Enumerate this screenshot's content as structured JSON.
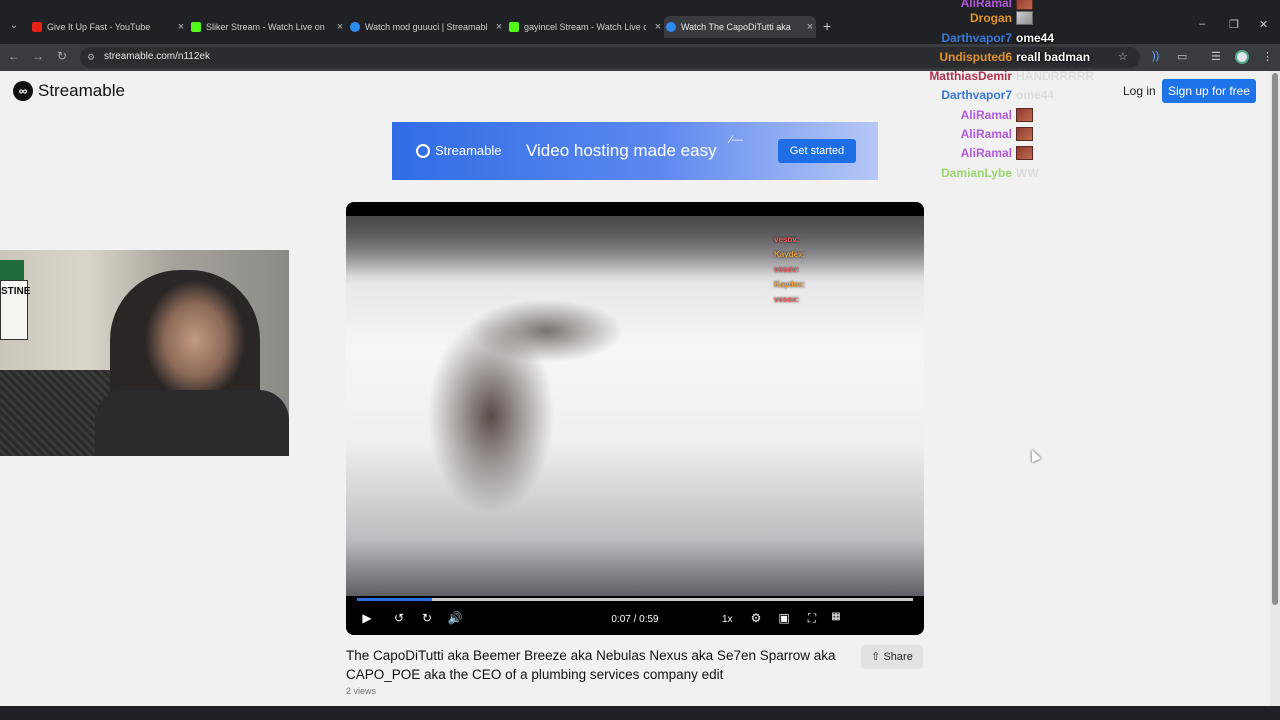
{
  "browser": {
    "tabs": [
      {
        "title": "Give It Up Fast - YouTube",
        "fav_color": "#e62117"
      },
      {
        "title": "Sliker Stream - Watch Live on K",
        "fav_color": "#53fc18"
      },
      {
        "title": "Watch mod guuuci | Streamable",
        "fav_color": "#2d8cf0"
      },
      {
        "title": "gayincel Stream - Watch Live on",
        "fav_color": "#53fc18"
      },
      {
        "title": "Watch The CapoDiTutti aka Bee",
        "fav_color": "#2d8cf0"
      }
    ],
    "url": "streamable.com/n112ek"
  },
  "site": {
    "logo": "Streamable",
    "login": "Log in",
    "signup": "Sign up for free"
  },
  "banner": {
    "logo": "Streamable",
    "text": "Video hosting made easy",
    "button": "Get started"
  },
  "player": {
    "time": "0:07 / 0:59",
    "speed": "1x",
    "progress_fraction": 0.135,
    "overlay_chat": [
      {
        "name": "vesov:",
        "color": "#ff5a5a"
      },
      {
        "name": "Kaydex:",
        "color": "#f2a23a"
      },
      {
        "name": "vesov:",
        "color": "#ff5a5a"
      },
      {
        "name": "Kaydex:",
        "color": "#f2a23a"
      },
      {
        "name": "vesox:",
        "color": "#ff5a5a"
      }
    ]
  },
  "video": {
    "title": "The CapoDiTutti aka Beemer Breeze aka Nebulas Nexus aka Se7en Sparrow aka CAPO_POE aka the CEO of a plumbing services company edit",
    "views": "2 views",
    "share": "Share"
  },
  "webcam": {
    "sign_text": "STINE"
  },
  "chat": [
    {
      "name": "AliRamal",
      "color": "#b25ad9",
      "msg": "",
      "emote": true
    },
    {
      "name": "Drogan",
      "color": "#e0932a",
      "msg": "",
      "emote": true
    },
    {
      "name": "Darthvapor7",
      "color": "#3a78d8",
      "msg": "ome44",
      "emote": false
    },
    {
      "name": "Undisputed6",
      "color": "#e0932a",
      "msg": "reall badman",
      "emote": false
    },
    {
      "name": "MatthiasDemir",
      "color": "#b0304a",
      "msg": "HANDRRRRR",
      "emote": false,
      "faded": true
    },
    {
      "name": "Darthvapor7",
      "color": "#3a78d8",
      "msg": "ome44",
      "emote": false,
      "faded": true
    },
    {
      "name": "AliRamal",
      "color": "#b25ad9",
      "msg": "",
      "emote": true
    },
    {
      "name": "AliRamal",
      "color": "#b25ad9",
      "msg": "",
      "emote": true
    },
    {
      "name": "AliRamal",
      "color": "#b25ad9",
      "msg": "",
      "emote": true
    },
    {
      "name": "DamianLybe",
      "color": "#9bd66e",
      "msg": "WW",
      "emote": false,
      "faded": true
    }
  ]
}
